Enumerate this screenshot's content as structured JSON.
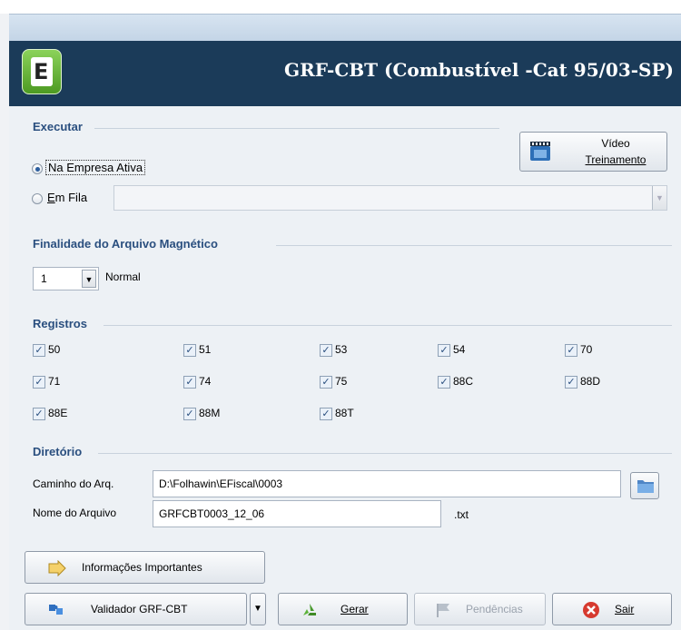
{
  "app": {
    "title": "GRF-CBT (Combustível -Cat 95/03-SP)",
    "logo_letter": "E"
  },
  "executar": {
    "title": "Executar",
    "opt_empresa": "Na Empresa Ativa",
    "opt_fila": "Em Fila",
    "fila_value": "",
    "video_line1": "Vídeo",
    "video_line2": "Treinamento"
  },
  "finalidade": {
    "title": "Finalidade do Arquivo Magnético",
    "value": "1",
    "desc": "Normal"
  },
  "registros": {
    "title": "Registros",
    "items": [
      {
        "label": "50",
        "checked": true
      },
      {
        "label": "51",
        "checked": true
      },
      {
        "label": "53",
        "checked": true
      },
      {
        "label": "54",
        "checked": true
      },
      {
        "label": "70",
        "checked": true
      },
      {
        "label": "71",
        "checked": true
      },
      {
        "label": "74",
        "checked": true
      },
      {
        "label": "75",
        "checked": true
      },
      {
        "label": "88C",
        "checked": true
      },
      {
        "label": "88D",
        "checked": true
      },
      {
        "label": "88E",
        "checked": true
      },
      {
        "label": "88M",
        "checked": true
      },
      {
        "label": "88T",
        "checked": true
      }
    ]
  },
  "diretorio": {
    "title": "Diretório",
    "caminho_label": "Caminho do Arq.",
    "caminho_value": "D:\\Folhawin\\EFiscal\\0003",
    "nome_label": "Nome do Arquivo",
    "nome_value": "GRFCBT0003_12_06",
    "ext": ".txt"
  },
  "buttons": {
    "info": "Informações Importantes",
    "validador": "Validador GRF-CBT",
    "gerar": "Gerar",
    "pendencias": "Pendências",
    "sair": "Sair"
  },
  "colors": {
    "header": "#1b3b59",
    "group_title": "#2a4f7f"
  },
  "icons": [
    "film-icon",
    "folder-icon",
    "arrow-icon",
    "puzzle-icon",
    "recycle-icon",
    "flag-icon",
    "close-icon",
    "dropdown-icon",
    "check-icon"
  ]
}
